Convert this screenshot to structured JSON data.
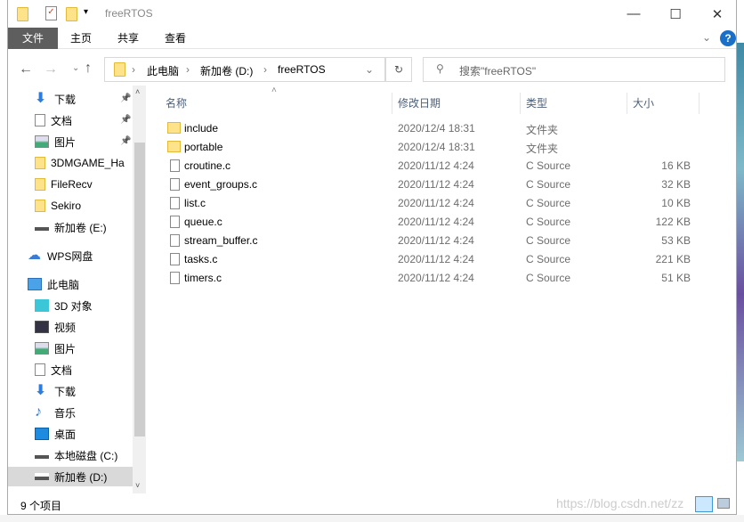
{
  "window": {
    "title": "freeRTOS",
    "minimize_icon": "minimize-icon",
    "maximize_icon": "maximize-icon",
    "close_icon": "close-icon"
  },
  "ribbon": {
    "tabs": [
      "文件",
      "主页",
      "共享",
      "查看"
    ]
  },
  "address": {
    "crumbs": [
      "此电脑",
      "新加卷 (D:)",
      "freeRTOS"
    ]
  },
  "search": {
    "placeholder": "搜索\"freeRTOS\""
  },
  "sidebar": {
    "items": [
      {
        "label": "下载",
        "icon": "download-icon",
        "pinned": true
      },
      {
        "label": "文档",
        "icon": "document-icon",
        "pinned": true
      },
      {
        "label": "图片",
        "icon": "picture-icon",
        "pinned": true
      },
      {
        "label": "3DMGAME_Ha",
        "icon": "folder-icon"
      },
      {
        "label": "FileRecv",
        "icon": "folder-icon"
      },
      {
        "label": "Sekiro",
        "icon": "folder-icon"
      },
      {
        "label": "新加卷 (E:)",
        "icon": "drive-icon"
      },
      {
        "label": "WPS网盘",
        "icon": "cloud-icon"
      },
      {
        "label": "此电脑",
        "icon": "computer-icon"
      },
      {
        "label": "3D 对象",
        "icon": "3d-icon"
      },
      {
        "label": "视频",
        "icon": "video-icon"
      },
      {
        "label": "图片",
        "icon": "picture-icon"
      },
      {
        "label": "文档",
        "icon": "document-icon"
      },
      {
        "label": "下载",
        "icon": "download-icon"
      },
      {
        "label": "音乐",
        "icon": "music-icon"
      },
      {
        "label": "桌面",
        "icon": "desktop-icon"
      },
      {
        "label": "本地磁盘 (C:)",
        "icon": "drive-icon"
      },
      {
        "label": "新加卷 (D:)",
        "icon": "drive-icon",
        "selected": true
      }
    ]
  },
  "columns": [
    "名称",
    "修改日期",
    "类型",
    "大小"
  ],
  "files": [
    {
      "name": "include",
      "date": "2020/12/4 18:31",
      "type": "文件夹",
      "size": "",
      "folder": true
    },
    {
      "name": "portable",
      "date": "2020/12/4 18:31",
      "type": "文件夹",
      "size": "",
      "folder": true
    },
    {
      "name": "croutine.c",
      "date": "2020/11/12 4:24",
      "type": "C Source",
      "size": "16 KB"
    },
    {
      "name": "event_groups.c",
      "date": "2020/11/12 4:24",
      "type": "C Source",
      "size": "32 KB"
    },
    {
      "name": "list.c",
      "date": "2020/11/12 4:24",
      "type": "C Source",
      "size": "10 KB"
    },
    {
      "name": "queue.c",
      "date": "2020/11/12 4:24",
      "type": "C Source",
      "size": "122 KB"
    },
    {
      "name": "stream_buffer.c",
      "date": "2020/11/12 4:24",
      "type": "C Source",
      "size": "53 KB"
    },
    {
      "name": "tasks.c",
      "date": "2020/11/12 4:24",
      "type": "C Source",
      "size": "221 KB"
    },
    {
      "name": "timers.c",
      "date": "2020/11/12 4:24",
      "type": "C Source",
      "size": "51 KB"
    }
  ],
  "status": {
    "count": "9 个项目"
  },
  "watermark": "https://blog.csdn.net/zz"
}
